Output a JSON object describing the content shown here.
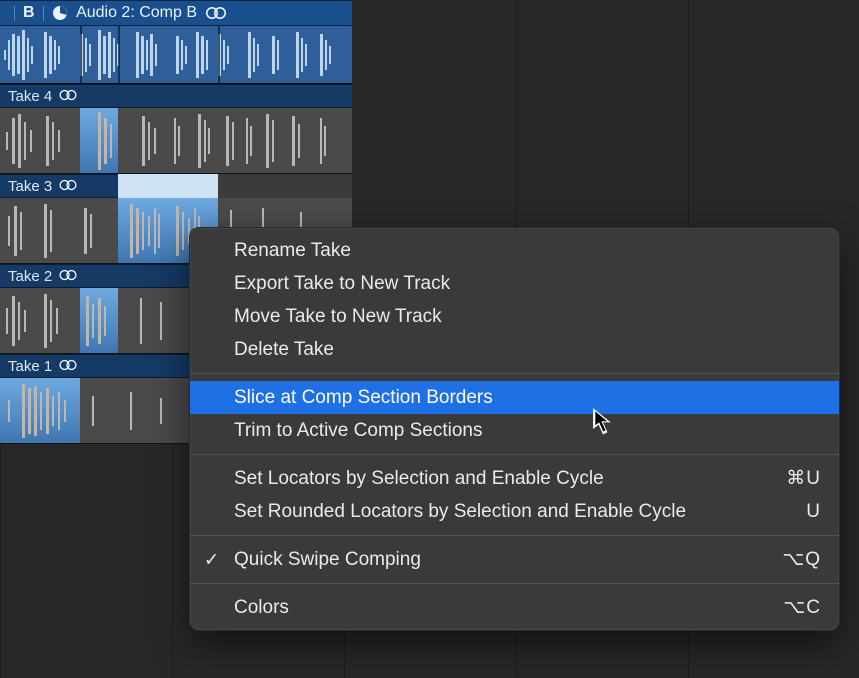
{
  "comp": {
    "title": "Audio 2: Comp B",
    "letter": "B",
    "icons": {
      "disclosure": "disclosure-triangle-icon",
      "pie": "take-folder-icon",
      "rings": "stereo-rings-icon"
    }
  },
  "takes": [
    {
      "label": "Take 4"
    },
    {
      "label": "Take 3"
    },
    {
      "label": "Take 2"
    },
    {
      "label": "Take 1"
    }
  ],
  "menu": {
    "groups": [
      [
        {
          "label": "Rename Take",
          "highlight": false
        },
        {
          "label": "Export Take to New Track",
          "highlight": false
        },
        {
          "label": "Move Take to New Track",
          "highlight": false
        },
        {
          "label": "Delete Take",
          "highlight": false
        }
      ],
      [
        {
          "label": "Slice at Comp Section Borders",
          "highlight": true
        },
        {
          "label": "Trim to Active Comp Sections",
          "highlight": false
        }
      ],
      [
        {
          "label": "Set Locators by Selection and Enable Cycle",
          "shortcut": "⌘U",
          "highlight": false
        },
        {
          "label": "Set Rounded Locators by Selection and Enable Cycle",
          "shortcut": "U",
          "highlight": false
        }
      ],
      [
        {
          "label": "Quick Swipe Comping",
          "shortcut": "⌥Q",
          "checked": true,
          "highlight": false
        }
      ],
      [
        {
          "label": "Colors",
          "shortcut": "⌥C",
          "highlight": false
        }
      ]
    ]
  }
}
